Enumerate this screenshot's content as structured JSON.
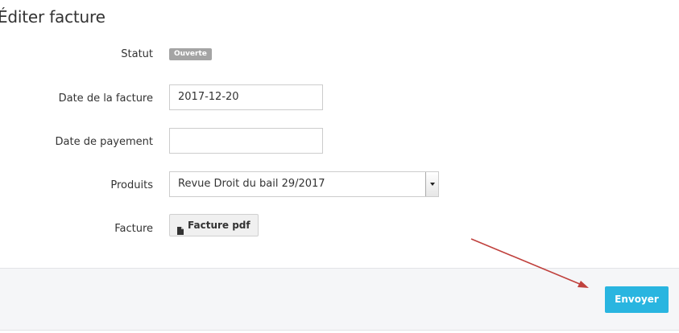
{
  "page": {
    "title": "Éditer facture"
  },
  "form": {
    "status": {
      "label": "Statut",
      "badge": "Ouverte"
    },
    "invoice_date": {
      "label": "Date de la facture",
      "value": "2017-12-20"
    },
    "payment_date": {
      "label": "Date de payement",
      "value": ""
    },
    "products": {
      "label": "Produits",
      "selected": "Revue Droit du bail 29/2017"
    },
    "invoice": {
      "label": "Facture",
      "button_label": "Facture pdf"
    }
  },
  "footer": {
    "submit_label": "Envoyer"
  },
  "colors": {
    "badge": "#a4a4a4",
    "submit": "#29b5e0",
    "annotation_arrow": "#c0413d",
    "footer_bg": "#f5f6f8"
  },
  "icons": {
    "file_button_icon": "file-icon",
    "select_toggle_icon": "chevron-down-icon"
  }
}
